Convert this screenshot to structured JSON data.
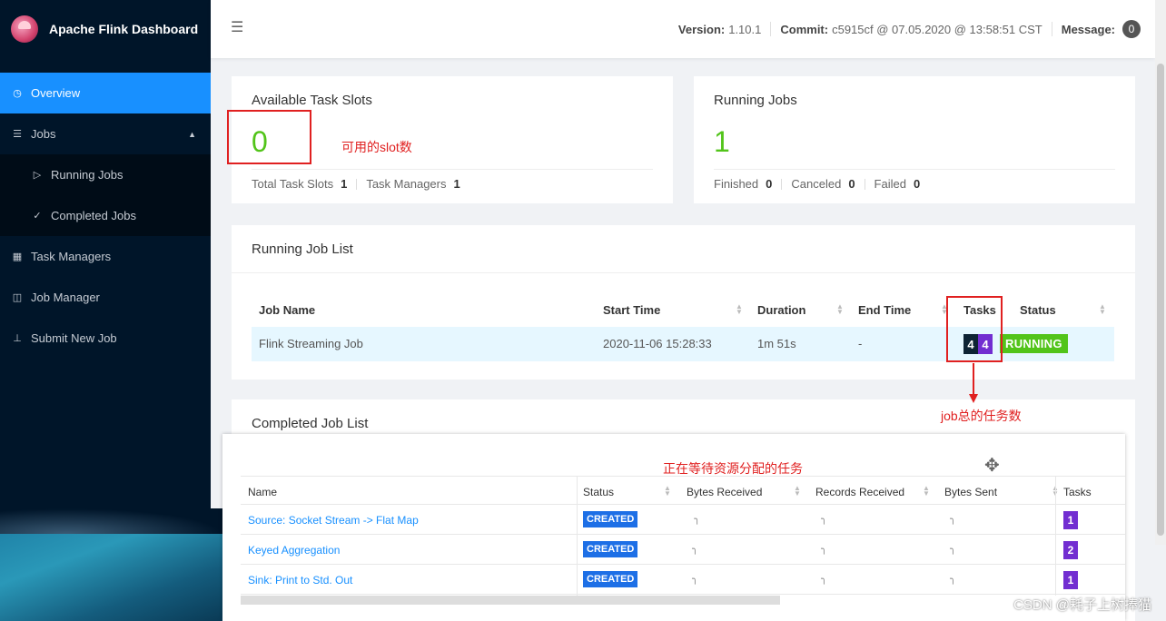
{
  "app": {
    "title": "Apache Flink Dashboard"
  },
  "sidebar": {
    "items": [
      {
        "label": "Overview",
        "icon": "dashboard-icon",
        "active": true
      },
      {
        "label": "Jobs",
        "icon": "list-icon"
      },
      {
        "label": "Running Jobs",
        "icon": "play-circle-icon"
      },
      {
        "label": "Completed Jobs",
        "icon": "check-circle-icon"
      },
      {
        "label": "Task Managers",
        "icon": "schedule-icon"
      },
      {
        "label": "Job Manager",
        "icon": "cluster-icon"
      },
      {
        "label": "Submit New Job",
        "icon": "upload-icon"
      }
    ]
  },
  "header": {
    "version_label": "Version:",
    "version": "1.10.1",
    "commit_label": "Commit:",
    "commit": "c5915cf @ 07.05.2020 @ 13:58:51 CST",
    "message_label": "Message:",
    "message_count": "0"
  },
  "slots_card": {
    "title": "Available Task Slots",
    "value": "0",
    "total_label": "Total Task Slots",
    "total_value": "1",
    "tm_label": "Task Managers",
    "tm_value": "1"
  },
  "jobs_card": {
    "title": "Running Jobs",
    "value": "1",
    "finished_label": "Finished",
    "finished_value": "0",
    "canceled_label": "Canceled",
    "canceled_value": "0",
    "failed_label": "Failed",
    "failed_value": "0"
  },
  "running_list": {
    "title": "Running Job List",
    "columns": [
      "Job Name",
      "Start Time",
      "Duration",
      "End Time",
      "Tasks",
      "Status"
    ],
    "rows": [
      {
        "name": "Flink Streaming Job",
        "start": "2020-11-06 15:28:33",
        "duration": "1m 51s",
        "end": "-",
        "tasks_a": "4",
        "tasks_b": "4",
        "status": "RUNNING"
      }
    ]
  },
  "completed_list": {
    "title": "Completed Job List"
  },
  "vertex_table": {
    "columns": [
      "Name",
      "Status",
      "Bytes Received",
      "Records Received",
      "Bytes Sent",
      "Tasks"
    ],
    "rows": [
      {
        "name": "Source: Socket Stream -> Flat Map",
        "status": "CREATED",
        "tasks": "1"
      },
      {
        "name": "Keyed Aggregation",
        "status": "CREATED",
        "tasks": "2"
      },
      {
        "name": "Sink: Print to Std. Out",
        "status": "CREATED",
        "tasks": "1"
      }
    ]
  },
  "annotations": {
    "slots": "可用的slot数",
    "tasks": "job总的任务数",
    "waiting": "正在等待资源分配的任务"
  },
  "watermark": "CSDN @耗子上树捧猫",
  "colors": {
    "sidebar": "#001529",
    "active": "#1890ff",
    "green": "#52c41a",
    "purple": "#722ed1",
    "annotation": "#e02020"
  }
}
